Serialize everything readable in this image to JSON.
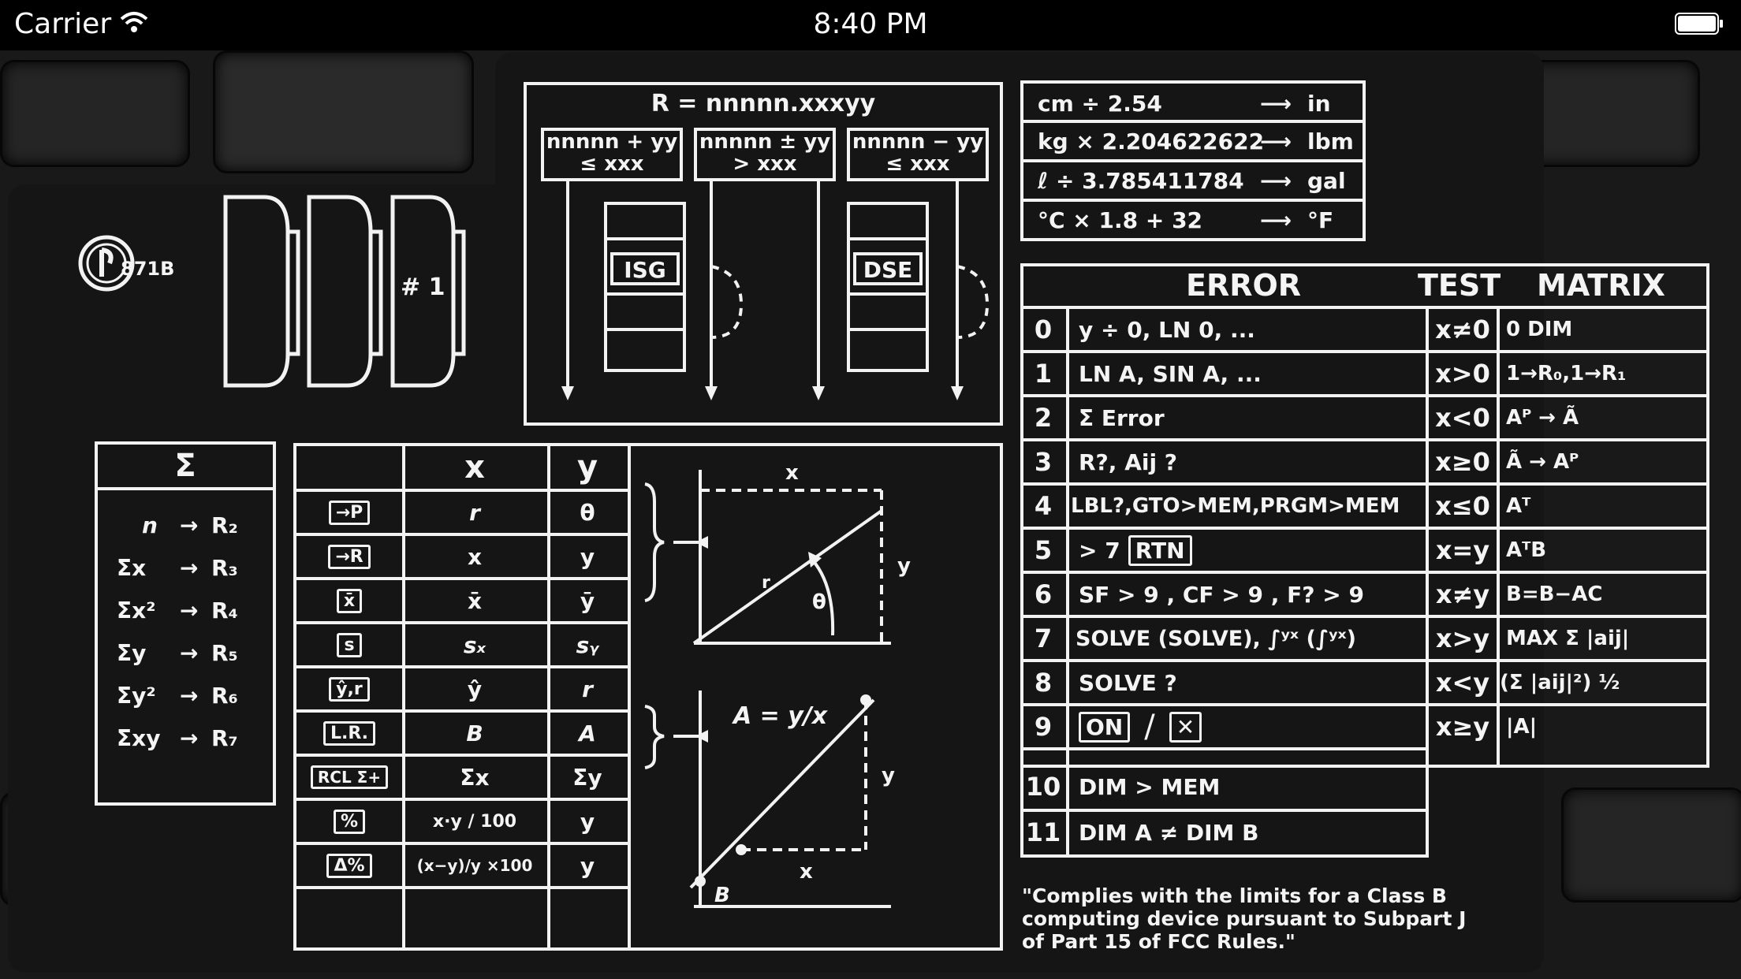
{
  "status_bar": {
    "carrier": "Carrier",
    "time": "8:40 PM"
  },
  "logo": {
    "text": "871B"
  },
  "cards": {
    "card3_label": "# 1"
  },
  "loop_diagram": {
    "title": "R = nnnnn.xxxyy",
    "boxes": [
      {
        "top": "nnnnn + yy",
        "bottom": "≤ xxx"
      },
      {
        "top": "nnnnn ± yy",
        "bottom": "> xxx"
      },
      {
        "top": "nnnnn − yy",
        "bottom": "≤ xxx"
      }
    ],
    "isg_label": "ISG",
    "dse_label": "DSE"
  },
  "conversions": [
    {
      "expr": "cm ÷ 2.54",
      "unit": "in"
    },
    {
      "expr": "kg × 2.204622622",
      "unit": "lbm"
    },
    {
      "expr": "ℓ ÷ 3.785411784",
      "unit": "gal"
    },
    {
      "expr": "°C × 1.8 + 32",
      "unit": "°F"
    }
  ],
  "error_table": {
    "headers": {
      "error": "ERROR",
      "test": "TEST",
      "matrix": "MATRIX"
    },
    "rows": [
      {
        "num": "0",
        "error": "y ÷ 0,  LN 0, ...",
        "test": "x≠0",
        "matrix": "0 DIM"
      },
      {
        "num": "1",
        "error": "LN A, SIN A, ...",
        "test": "x>0",
        "matrix": "1→R₀,1→R₁"
      },
      {
        "num": "2",
        "error": "Σ Error",
        "test": "x<0",
        "matrix": "Aᴾ → Ã"
      },
      {
        "num": "3",
        "error": "R?, Aij ?",
        "test": "x≥0",
        "matrix": "Ã → Aᴾ"
      },
      {
        "num": "4",
        "error": "LBL?,GTO>MEM,PRGM>MEM",
        "test": "x≤0",
        "matrix": "Aᵀ"
      },
      {
        "num": "5",
        "error": "> 7",
        "error_key": "RTN",
        "test": "x=y",
        "matrix": "AᵀB"
      },
      {
        "num": "6",
        "error": "SF > 9 , CF > 9 , F? > 9",
        "test": "x≠y",
        "matrix": "B=B−AC"
      },
      {
        "num": "7",
        "error": "SOLVE (SOLVE), ∫ʸˣ (∫ʸˣ)",
        "test": "x>y",
        "matrix": "MAX Σ |aij|"
      },
      {
        "num": "8",
        "error": "SOLVE ?",
        "test": "x<y",
        "matrix": "(Σ |aij|²) ½"
      },
      {
        "num": "9",
        "error_key": "ON",
        "error_sep": "/",
        "error_key2": "✕",
        "test": "x≥y",
        "matrix": "|A|"
      },
      {
        "num": "10",
        "error": "DIM > MEM"
      },
      {
        "num": "11",
        "error": "DIM A ≠ DIM B"
      }
    ]
  },
  "sigma_table": {
    "header": "Σ",
    "rows": [
      {
        "label": "n",
        "reg": "R₂"
      },
      {
        "label": "Σx",
        "reg": "R₃"
      },
      {
        "label": "Σx²",
        "reg": "R₄"
      },
      {
        "label": "Σy",
        "reg": "R₅"
      },
      {
        "label": "Σy²",
        "reg": "R₆"
      },
      {
        "label": "Σxy",
        "reg": "R₇"
      }
    ]
  },
  "stats_table": {
    "headers": {
      "x": "x",
      "y": "y"
    },
    "rows": [
      {
        "key": "→P",
        "x": "r",
        "y": "θ"
      },
      {
        "key": "→R",
        "x": "x",
        "y": "y"
      },
      {
        "key": "x̄",
        "x": "x̄",
        "y": "ȳ"
      },
      {
        "key": "s",
        "x": "sₓ",
        "y": "sᵧ"
      },
      {
        "key": "ŷ,r",
        "x": "ŷ",
        "y": "r"
      },
      {
        "key": "L.R.",
        "x": "B",
        "y": "A"
      },
      {
        "key": "RCL Σ+",
        "x": "Σx",
        "y": "Σy"
      },
      {
        "key": "%",
        "x": "x·y / 100",
        "y": "y"
      },
      {
        "key": "Δ%",
        "x": "(x−y)/y ×100",
        "y": "y"
      }
    ]
  },
  "graphs": {
    "polar": {
      "x": "x",
      "y": "y",
      "r": "r",
      "theta": "θ"
    },
    "linear": {
      "eq": "A = y/x",
      "x": "x",
      "y": "y",
      "b": "B"
    }
  },
  "fcc_notice": "\"Complies with the limits for a Class B computing device pursuant to Subpart J of Part 15 of FCC Rules.\""
}
